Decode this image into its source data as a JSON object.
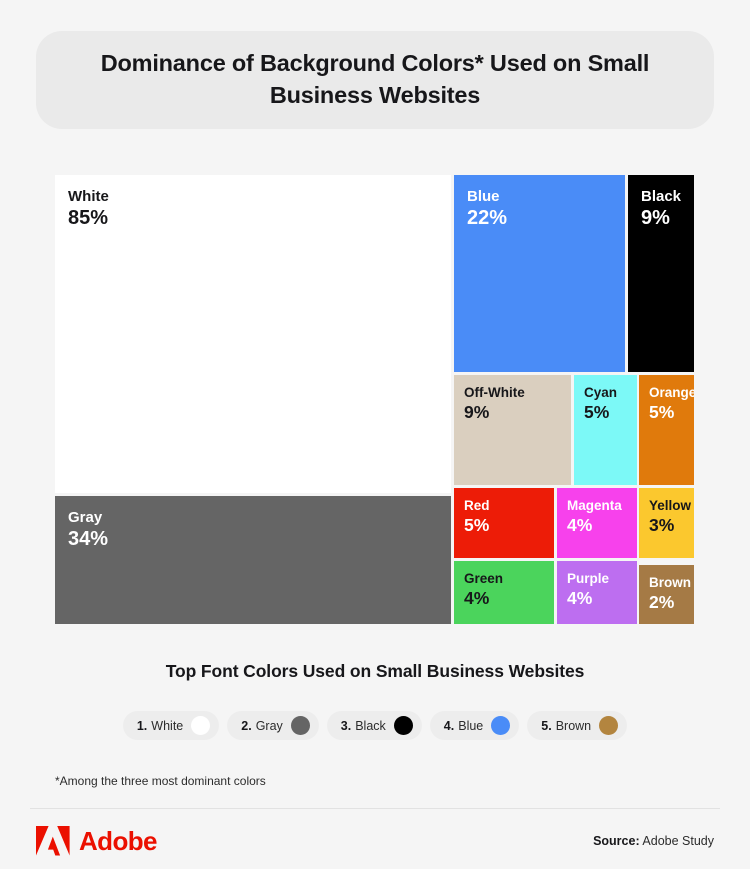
{
  "header": {
    "title": "Dominance of Background Colors* Used on Small Business Websites"
  },
  "chart_data": {
    "type": "treemap",
    "title": "Dominance of Background Colors* Used on Small Business Websites",
    "unit": "%",
    "note": "*Among the three most dominant colors",
    "categories": [
      "White",
      "Blue",
      "Black",
      "Off-White",
      "Cyan",
      "Orange",
      "Gray",
      "Red",
      "Magenta",
      "Yellow",
      "Green",
      "Purple",
      "Brown"
    ],
    "values": [
      85,
      22,
      9,
      9,
      5,
      5,
      34,
      5,
      4,
      3,
      4,
      4,
      2
    ],
    "tiles": [
      {
        "label": "White",
        "value": "85%",
        "pct": 85,
        "fill": "#ffffff",
        "text": "#17171a"
      },
      {
        "label": "Blue",
        "value": "22%",
        "pct": 22,
        "fill": "#4a8cf7",
        "text": "#ffffff"
      },
      {
        "label": "Black",
        "value": "9%",
        "pct": 9,
        "fill": "#000000",
        "text": "#ffffff"
      },
      {
        "label": "Off-White",
        "value": "9%",
        "pct": 9,
        "fill": "#dacfbf",
        "text": "#17171a"
      },
      {
        "label": "Cyan",
        "value": "5%",
        "pct": 5,
        "fill": "#7cf9f7",
        "text": "#17171a"
      },
      {
        "label": "Orange",
        "value": "5%",
        "pct": 5,
        "fill": "#e07a0c",
        "text": "#ffffff"
      },
      {
        "label": "Gray",
        "value": "34%",
        "pct": 34,
        "fill": "#656565",
        "text": "#ffffff"
      },
      {
        "label": "Red",
        "value": "5%",
        "pct": 5,
        "fill": "#ed1c07",
        "text": "#ffffff"
      },
      {
        "label": "Magenta",
        "value": "4%",
        "pct": 4,
        "fill": "#f741ec",
        "text": "#ffffff"
      },
      {
        "label": "Yellow",
        "value": "3%",
        "pct": 3,
        "fill": "#fbc party",
        "text": "#17171a"
      },
      {
        "label": "Green",
        "value": "4%",
        "pct": 4,
        "fill": "#4bd košt",
        "text": "#17171a"
      },
      {
        "label": "Purple",
        "value": "4%",
        "pct": 4,
        "fill": "#bd6ef0",
        "text": "#ffffff"
      },
      {
        "label": "Brown",
        "value": "2%",
        "pct": 2,
        "fill": "#a57a45",
        "text": "#ffffff"
      }
    ]
  },
  "font_colors": {
    "title": "Top Font Colors Used on Small Business Websites",
    "items": [
      {
        "rank": "1.",
        "name": "White",
        "color": "#ffffff"
      },
      {
        "rank": "2.",
        "name": "Gray",
        "color": "#656565"
      },
      {
        "rank": "3.",
        "name": "Black",
        "color": "#000000"
      },
      {
        "rank": "4.",
        "name": "Blue",
        "color": "#4a8cf7"
      },
      {
        "rank": "5.",
        "name": "Brown",
        "color": "#b3853f"
      }
    ]
  },
  "footnote": "*Among the three most dominant colors",
  "footer": {
    "brand": "Adobe",
    "source_label": "Source:",
    "source_value": "Adobe Study"
  }
}
